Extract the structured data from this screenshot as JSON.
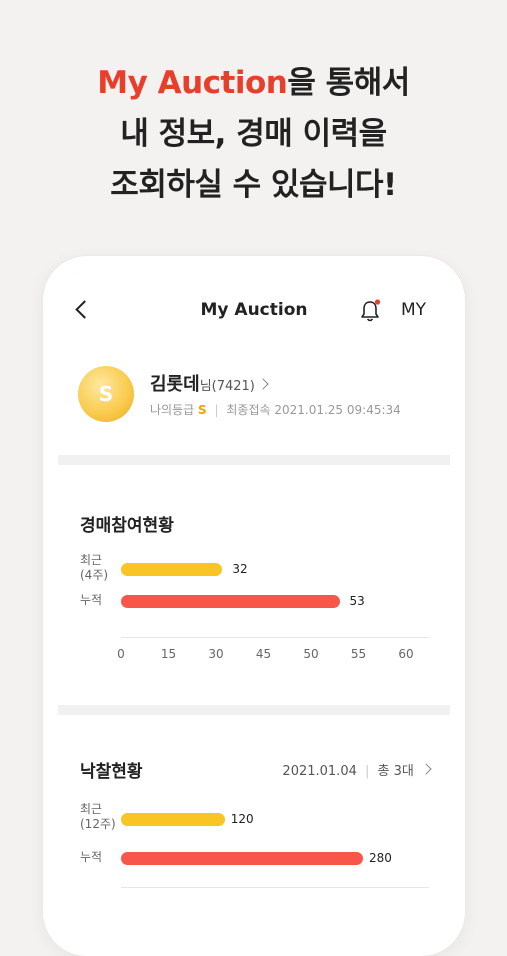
{
  "headline": {
    "line1_accent": "My Auction",
    "line1_rest": "을 통해서",
    "line2": "내 정보, 경매 이력을",
    "line3": "조회하실 수 있습니다!"
  },
  "appbar": {
    "title": "My Auction",
    "my_label": "MY"
  },
  "profile": {
    "avatar_grade": "S",
    "name": "김롯데",
    "name_suffix": "님(7421)",
    "grade_label": "나의등급",
    "grade_value": "S",
    "last_login_label": "최종접속",
    "last_login_value": "2021.01.25 09:45:34"
  },
  "participation": {
    "title": "경매참여현황",
    "rows": [
      {
        "label_line1": "최근",
        "label_line2": "(4주)",
        "value": 32,
        "value_text": "32",
        "color": "#f9c524"
      },
      {
        "label_line1": "누적",
        "label_line2": "",
        "value": 53,
        "value_text": "53",
        "color": "#f7574a"
      }
    ],
    "ticks": [
      "0",
      "15",
      "30",
      "45",
      "50",
      "55",
      "60"
    ]
  },
  "winning": {
    "title": "낙찰현황",
    "date": "2021.01.04",
    "total": "총 3대",
    "rows": [
      {
        "label_line1": "최근",
        "label_line2": "(12주)",
        "value": 120,
        "value_text": "120",
        "color": "#f9c524"
      },
      {
        "label_line1": "누적",
        "label_line2": "",
        "value": 280,
        "value_text": "280",
        "color": "#f7574a"
      }
    ]
  },
  "colors": {
    "accent": "#e83e2c",
    "bar_recent": "#f9c524",
    "bar_total": "#f7574a",
    "grade": "#f0a500"
  }
}
